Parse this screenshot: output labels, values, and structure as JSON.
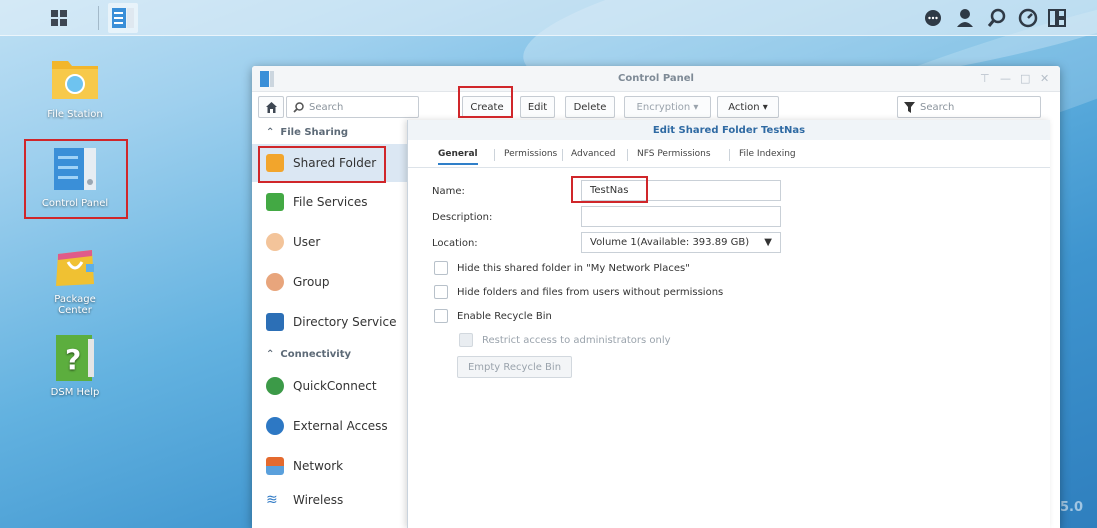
{
  "desktop": {
    "icons": [
      {
        "label": "File Station"
      },
      {
        "label": "Control Panel"
      },
      {
        "label": "Package Center"
      },
      {
        "label": "DSM Help"
      }
    ],
    "version_watermark": "5.0"
  },
  "window": {
    "title": "Control Panel",
    "left_search_placeholder": "Search",
    "right_search_placeholder": "Search",
    "toolbar": {
      "create": "Create",
      "edit": "Edit",
      "delete": "Delete",
      "encryption": "Encryption ▾",
      "action": "Action ▾"
    }
  },
  "sidebar": {
    "file_sharing_header": "File Sharing",
    "connectivity_header": "Connectivity",
    "items": [
      {
        "label": "Shared Folder"
      },
      {
        "label": "File Services"
      },
      {
        "label": "User"
      },
      {
        "label": "Group"
      },
      {
        "label": "Directory Service"
      },
      {
        "label": "QuickConnect"
      },
      {
        "label": "External Access"
      },
      {
        "label": "Network"
      },
      {
        "label": "Wireless"
      }
    ]
  },
  "dialog": {
    "title": "Edit Shared Folder TestNas",
    "tabs": [
      "General",
      "Permissions",
      "Advanced",
      "NFS Permissions",
      "File Indexing"
    ],
    "name_label": "Name:",
    "name_value": "TestNas",
    "description_label": "Description:",
    "description_value": "",
    "location_label": "Location:",
    "location_value": "Volume 1(Available: 393.89 GB)",
    "options": [
      "Hide this shared folder in \"My Network Places\"",
      "Hide folders and files from users without permissions",
      "Enable Recycle Bin"
    ],
    "restrict_label": "Restrict access to administrators only",
    "empty_recycle_bin": "Empty Recycle Bin"
  },
  "colors": {
    "highlight_box": "#d0262a",
    "accent": "#2f7fc9"
  }
}
